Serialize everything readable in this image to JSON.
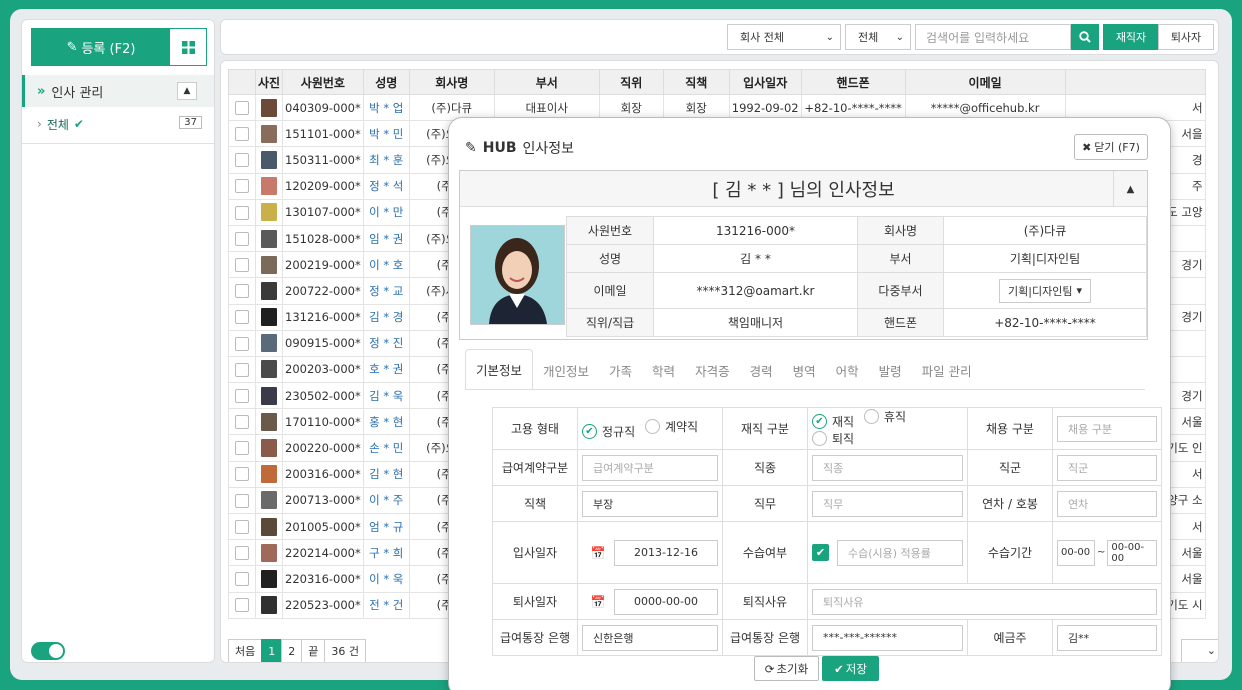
{
  "sidebar": {
    "register_label": "등록 (F2)",
    "tree_head": "인사 관리",
    "tree_item": "전체",
    "tree_count": "37"
  },
  "topbar": {
    "company_select": "회사 전체",
    "scope_select": "전체",
    "search_placeholder": "검색어를 입력하세요",
    "tab_active": "재직자",
    "tab_inactive": "퇴사자"
  },
  "list": {
    "headers": [
      "사진",
      "사원번호",
      "성명",
      "회사명",
      "부서",
      "직위",
      "직책",
      "입사일자",
      "핸드폰",
      "이메일"
    ],
    "rows": [
      {
        "id": "040309-000*",
        "name": "박 * 업",
        "company": "(주)다큐",
        "dept": "대표이사",
        "pos": "회장",
        "role": "회장",
        "date": "1992-09-02",
        "phone": "+82-10-****-****",
        "email": "*****@officehub.kr",
        "extra": "서"
      },
      {
        "id": "151101-000*",
        "name": "박 * 민",
        "company": "(주)오피스",
        "extra": "서을"
      },
      {
        "id": "150311-000*",
        "name": "최 * 훈",
        "company": "(주)오피스",
        "extra": "경"
      },
      {
        "id": "120209-000*",
        "name": "정 * 석",
        "company": "(주)다",
        "extra": "주"
      },
      {
        "id": "130107-000*",
        "name": "이 * 만",
        "company": "(주)다",
        "extra": "|도 고양"
      },
      {
        "id": "151028-000*",
        "name": "임 * 권",
        "company": "(주)오피스",
        "extra": ""
      },
      {
        "id": "200219-000*",
        "name": "이 * 호",
        "company": "(주)다",
        "extra": "경기"
      },
      {
        "id": "200722-000*",
        "name": "정 * 교",
        "company": "(주)사무기",
        "extra": ""
      },
      {
        "id": "131216-000*",
        "name": "김 * 경",
        "company": "(주)다",
        "extra": "경기"
      },
      {
        "id": "090915-000*",
        "name": "정 * 진",
        "company": "(주)다",
        "extra": ""
      },
      {
        "id": "200203-000*",
        "name": "호 * 권",
        "company": "(주)다",
        "extra": ""
      },
      {
        "id": "230502-000*",
        "name": "김 * 욱",
        "company": "(주)다",
        "extra": "경기"
      },
      {
        "id": "170110-000*",
        "name": "홍 * 현",
        "company": "(주)다",
        "extra": "서울"
      },
      {
        "id": "200220-000*",
        "name": "손 * 민",
        "company": "(주)오피스",
        "extra": "경기도 인"
      },
      {
        "id": "200316-000*",
        "name": "김 * 현",
        "company": "(주)다",
        "extra": "서"
      },
      {
        "id": "200713-000*",
        "name": "이 * 주",
        "company": "(주)다",
        "extra": "양구 소"
      },
      {
        "id": "201005-000*",
        "name": "엄 * 규",
        "company": "(주)다",
        "extra": "서"
      },
      {
        "id": "220214-000*",
        "name": "구 * 희",
        "company": "(주)다",
        "extra": "서울"
      },
      {
        "id": "220316-000*",
        "name": "이 * 욱",
        "company": "(주)다",
        "extra": "서울"
      },
      {
        "id": "220523-000*",
        "name": "전 * 건",
        "company": "(주)다",
        "extra": "기도 시"
      }
    ]
  },
  "pager": {
    "first": "처음",
    "p1": "1",
    "p2": "2",
    "last": "끝",
    "total": "36 건"
  },
  "modal": {
    "brand": "HUB",
    "title": "인사정보",
    "close_label": "닫기 (F7)",
    "heading": "[ 김 * *   ] 님의 인사정보",
    "info": {
      "emp_no_label": "사원번호",
      "emp_no": "131216-000*",
      "company_label": "회사명",
      "company": "(주)다큐",
      "name_label": "성명",
      "name": "김 * *",
      "dept_label": "부서",
      "dept": "기획|디자인팀",
      "email_label": "이메일",
      "email": "****312@oamart.kr",
      "multi_dept_label": "다중부서",
      "multi_dept": "기획|디자인팀",
      "position_label": "직위/직급",
      "position": "책임매니저",
      "phone_label": "핸드폰",
      "phone": "+82-10-****-****"
    },
    "tabs": [
      "기본정보",
      "개인정보",
      "가족",
      "학력",
      "자격증",
      "경력",
      "병역",
      "어학",
      "발령",
      "파일 관리"
    ],
    "form": {
      "emp_type_label": "고용 형태",
      "emp_type_opt1": "정규직",
      "emp_type_opt2": "계약직",
      "status_label": "재직 구분",
      "status_opt1": "재직",
      "status_opt2": "휴직",
      "status_opt3": "퇴직",
      "hire_type_label": "채용 구분",
      "hire_type_ph": "채용 구분",
      "salary_type_label": "급여계약구분",
      "salary_type_ph": "급여계약구분",
      "job_kind_label": "직종",
      "job_kind_ph": "직종",
      "job_group_label": "직군",
      "job_group_ph": "직군",
      "duty_label": "직책",
      "duty": "부장",
      "job_label": "직무",
      "job_ph": "직무",
      "annual_label": "연차 / 호봉",
      "annual_ph": "연차",
      "hire_date_label": "입사일자",
      "hire_date": "2013-12-16",
      "probation_label": "수습여부",
      "probation_ph": "수습(시용) 적용률",
      "probation_period_label": "수습기간",
      "probation_from": "00-00",
      "probation_sep": "~",
      "probation_to": "00-00-00",
      "retire_date_label": "퇴사일자",
      "retire_date": "0000-00-00",
      "retire_reason_label": "퇴직사유",
      "retire_reason_ph": "퇴직사유",
      "bank_label": "급여통장 은행",
      "bank": "신한은행",
      "account_label": "급여통장 은행",
      "account": "***-***-******",
      "holder_label": "예금주",
      "holder": "김**"
    },
    "reset_label": "초기화",
    "save_label": "저장"
  },
  "colors": {
    "accent": "#1aa37f"
  }
}
